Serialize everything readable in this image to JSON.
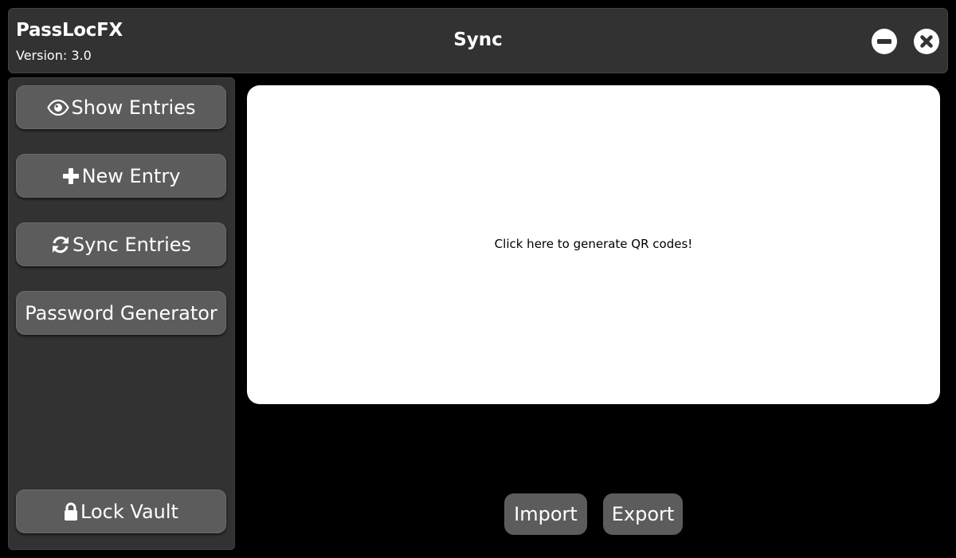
{
  "header": {
    "app_name": "PassLocFX",
    "version": "Version: 3.0",
    "page_title": "Sync",
    "minimize_icon": "minus-circle-icon",
    "close_icon": "x-circle-icon"
  },
  "sidebar": {
    "items": [
      {
        "label": "Show Entries",
        "icon": "eye-icon"
      },
      {
        "label": "New Entry",
        "icon": "plus-icon"
      },
      {
        "label": "Sync Entries",
        "icon": "sync-icon"
      },
      {
        "label": "Password Generator",
        "icon": ""
      }
    ],
    "lock_button": {
      "label": "Lock Vault",
      "icon": "lock-icon"
    }
  },
  "main": {
    "qr_prompt": "Click here to generate QR codes!",
    "import_label": "Import",
    "export_label": "Export"
  },
  "colors": {
    "background": "#000000",
    "panel": "#323232",
    "button": "#5c5c5c",
    "content": "#ffffff"
  }
}
